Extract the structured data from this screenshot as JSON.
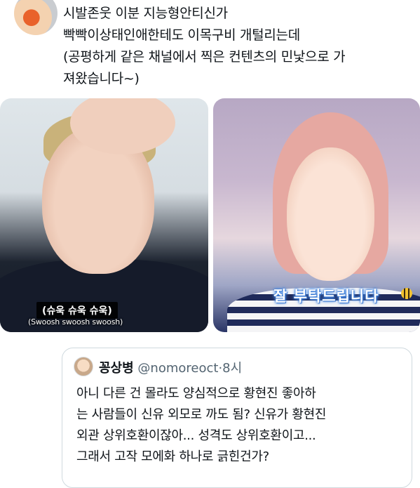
{
  "tweet": {
    "lines": [
      "시발존웃 이분 지능형안티신가",
      "빡빡이상태인애한테도 이목구비 개털리는데",
      "(공평하게 같은 채널에서 찍은 컨텐츠의 민낯으로 가",
      "져왔습니다~)"
    ]
  },
  "media": {
    "left": {
      "caption_ko": "(슈욱 슈욱 슈욱)",
      "caption_en": "(Swoosh swoosh swoosh)"
    },
    "right": {
      "sticker_text": "잘 부탁드립니다",
      "sticker_icon": "bee-icon"
    }
  },
  "quoted_tweet": {
    "display_name": "꽁상병",
    "handle": "@nomoreoct",
    "separator": "·",
    "time": "8시",
    "lines": [
      "아니 다른 건 몰라도 양심적으로 황현진 좋아하",
      "는 사람들이 신유 외모로 까도 됨? 신유가 황현진",
      "외관 상위호환이잖아... 성격도 상위호환이고...",
      "그래서 고작 모에화 하나로 긁힌건가?"
    ]
  }
}
